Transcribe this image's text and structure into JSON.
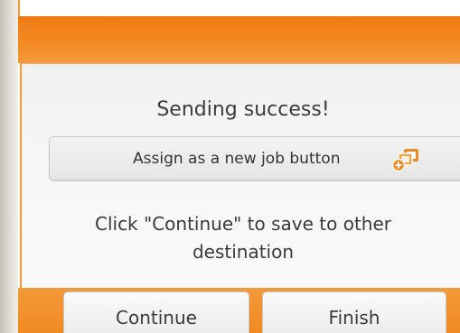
{
  "dialog": {
    "title": "Sending success!",
    "assign_button": {
      "label": "Assign as a new job button",
      "icon": "new-job-icon"
    },
    "message_line1": "Click \"Continue\" to save to other",
    "message_line2": "destination"
  },
  "actions": {
    "continue_label": "Continue",
    "finish_label": "Finish"
  },
  "colors": {
    "accent": "#f07a14",
    "accent_light": "#f39a3a",
    "dialog_bg": "#f4f4f4",
    "icon_orange": "#f08a22"
  }
}
